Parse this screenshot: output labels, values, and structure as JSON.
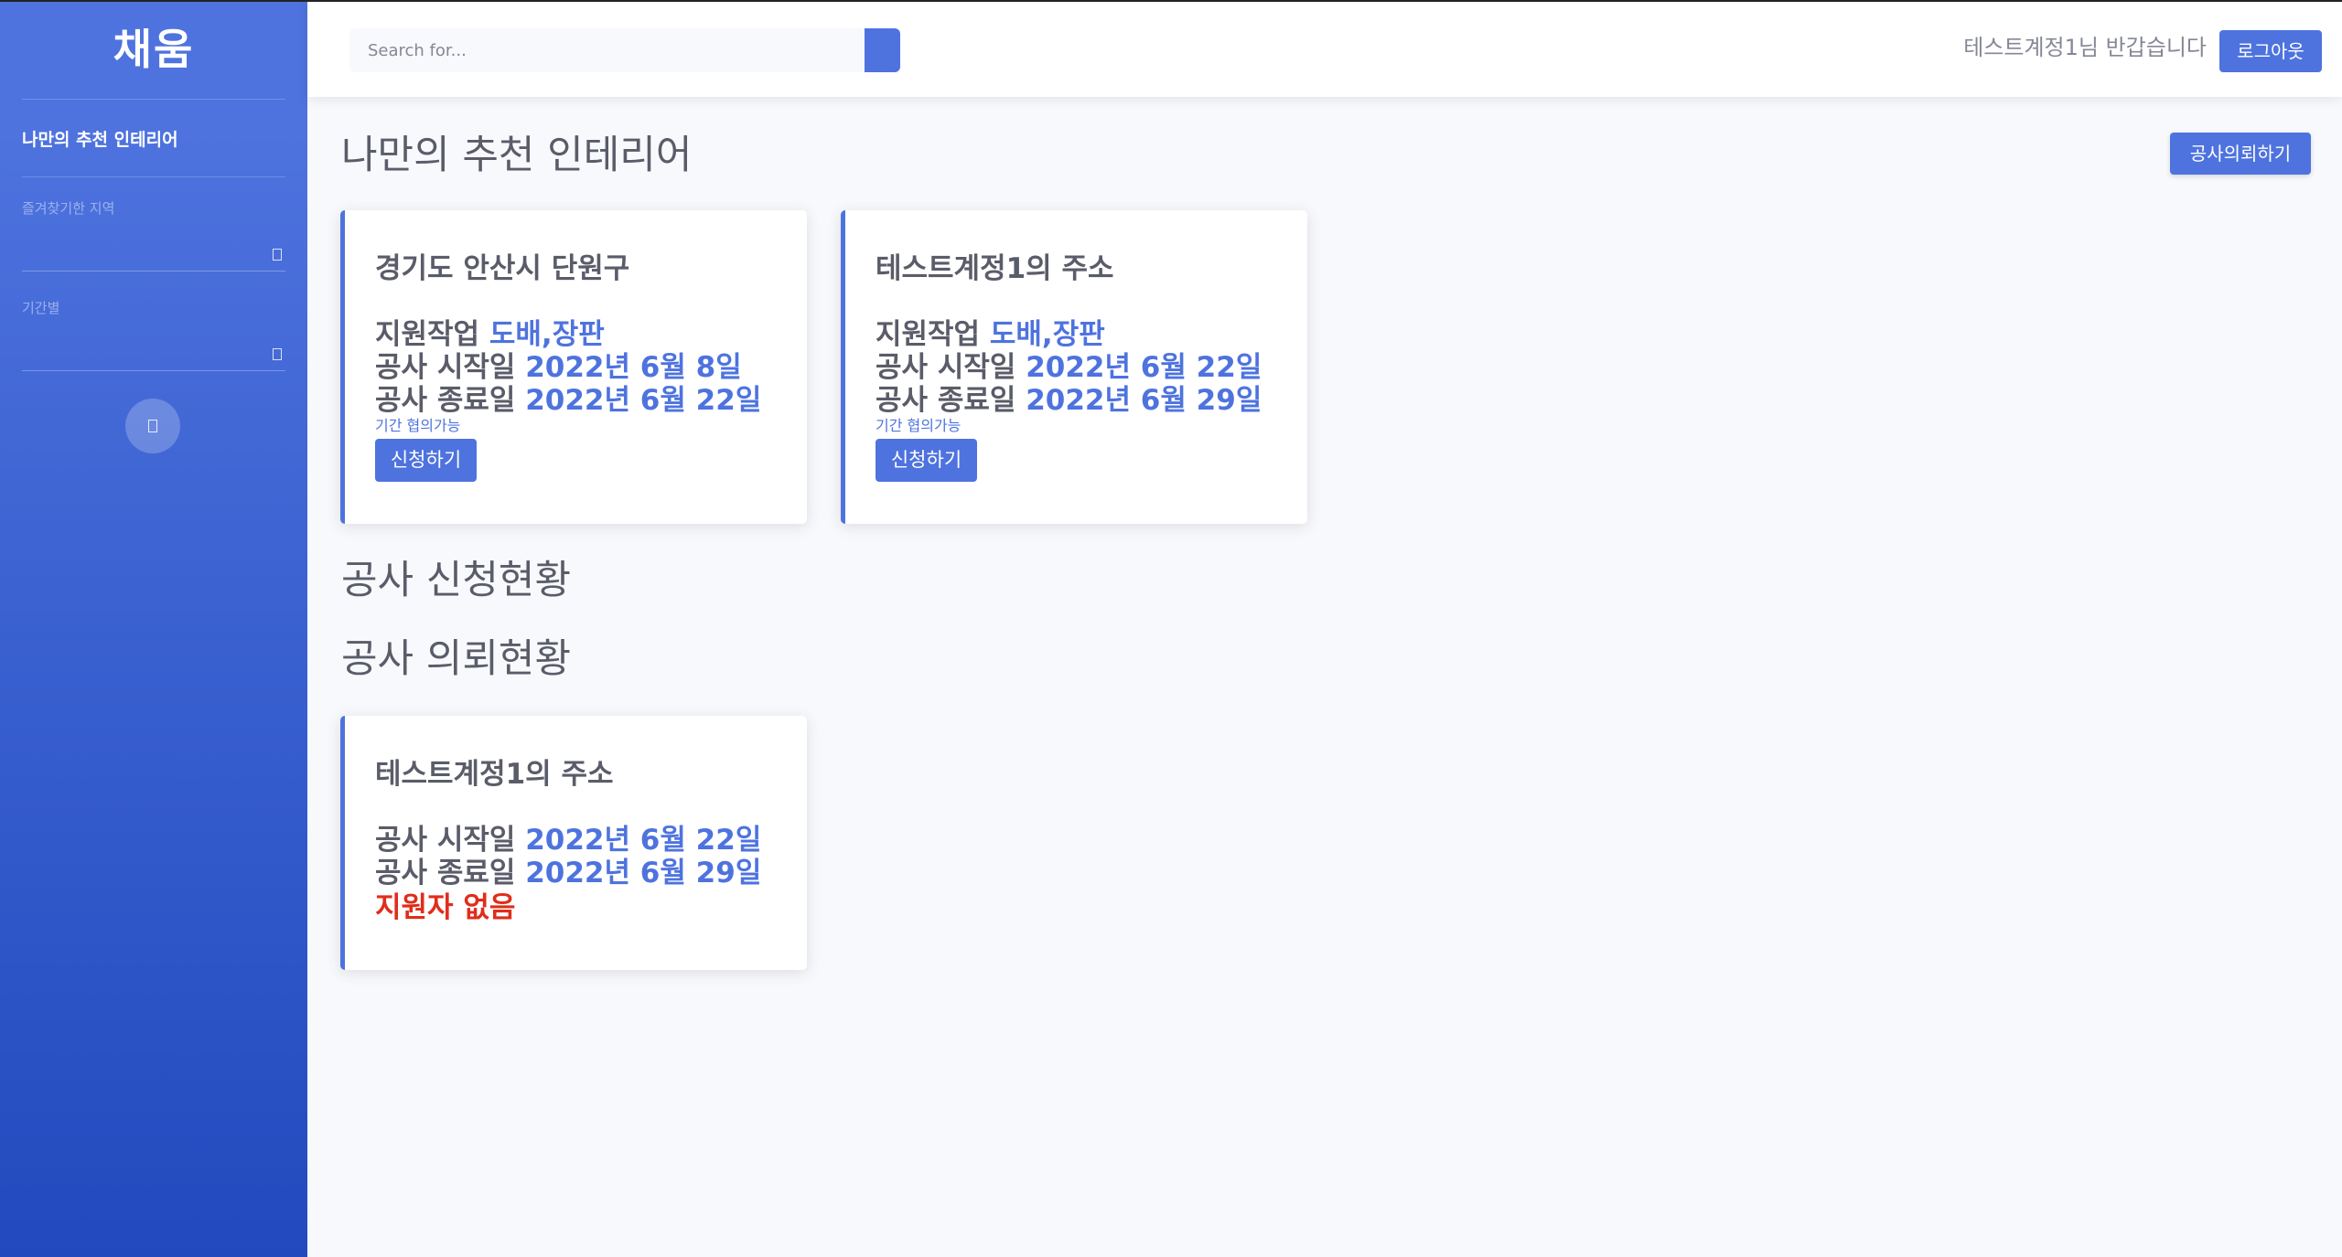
{
  "sidebar": {
    "brand": "채움",
    "nav_active": "나만의 추천 인테리어",
    "favorite_region_label": "즐겨찾기한 지역",
    "period_label": "기간별"
  },
  "topbar": {
    "search_placeholder": "Search for...",
    "welcome": "테스트계정1님 반갑습니다",
    "logout_label": "로그아웃"
  },
  "main": {
    "recommend_title": "나만의 추천 인테리어",
    "request_button": "공사의뢰하기",
    "recommend_cards": [
      {
        "title": "경기도 안산시 단원구",
        "support_label": "지원작업",
        "support_value": "도배,장판",
        "start_label": "공사 시작일",
        "start_value": "2022년 6월 8일",
        "end_label": "공사 종료일",
        "end_value": "2022년 6월 22일",
        "note": "기간 협의가능",
        "apply_label": "신청하기"
      },
      {
        "title": "테스트계정1의 주소",
        "support_label": "지원작업",
        "support_value": "도배,장판",
        "start_label": "공사 시작일",
        "start_value": "2022년 6월 22일",
        "end_label": "공사 종료일",
        "end_value": "2022년 6월 29일",
        "note": "기간 협의가능",
        "apply_label": "신청하기"
      }
    ],
    "application_status_title": "공사 신청현황",
    "request_status_title": "공사 의뢰현황",
    "request_cards": [
      {
        "title": "테스트계정1의 주소",
        "start_label": "공사 시작일",
        "start_value": "2022년 6월 22일",
        "end_label": "공사 종료일",
        "end_value": "2022년 6월 29일",
        "status": "지원자 없음"
      }
    ]
  },
  "colors": {
    "primary": "#4e73df",
    "sidebar_gradient_end": "#224abe",
    "text": "#5a5c69",
    "danger": "#e02d1b",
    "background": "#f8f9fc"
  }
}
